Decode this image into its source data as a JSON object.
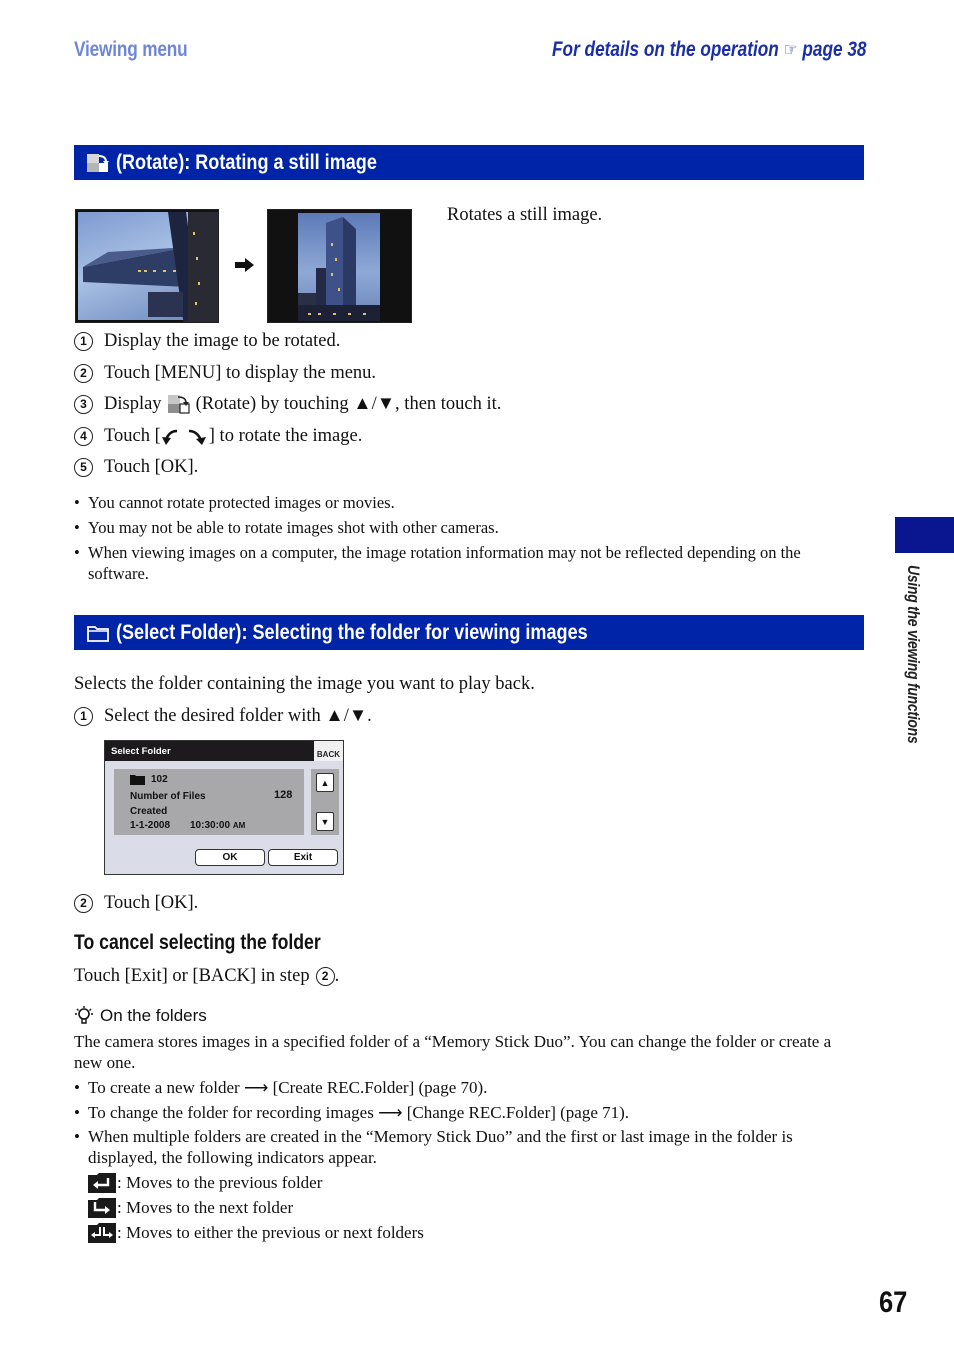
{
  "header": {
    "section_name": "Viewing menu",
    "details_prefix": "For details on the operation",
    "details_icon": "pointing-hand-icon",
    "details_page": "page 38"
  },
  "rotate_section": {
    "title": "(Rotate): Rotating a still image",
    "icon": "rotate-icon",
    "description": "Rotates a still image.",
    "before_image": "landscape-building-photo",
    "after_image": "portrait-building-photo",
    "steps": [
      {
        "num": "1",
        "text": "Display the image to be rotated."
      },
      {
        "num": "2",
        "text": "Touch [MENU] to display the menu."
      },
      {
        "num": "3",
        "text_before": "Display",
        "text_after": "(Rotate) by touching ▲/▼, then touch it."
      },
      {
        "num": "4",
        "text_before": "Touch [",
        "text_after": "] to rotate the image."
      },
      {
        "num": "5",
        "text": "Touch [OK]."
      }
    ],
    "notes": [
      "You cannot rotate protected images or movies.",
      "You may not be able to rotate images shot with other cameras.",
      "When viewing images on a computer, the image rotation information may not be reflected depending on the software."
    ]
  },
  "folder_section": {
    "title": "(Select Folder): Selecting the folder for viewing images",
    "icon": "folder-icon",
    "description": "Selects the folder containing the image you want to play back.",
    "steps": [
      {
        "num": "1",
        "text": "Select the desired folder with ▲/▼."
      },
      {
        "num": "2",
        "text": "Touch [OK]."
      }
    ],
    "camera_screen": {
      "title": "Select Folder",
      "back": "BACK",
      "folder_name": "102",
      "files_label": "Number of Files",
      "files_count": "128",
      "created_label": "Created",
      "created_date": "1-1-2008",
      "created_time": "10:30:00",
      "created_ampm": "AM",
      "up_arrow": "▲",
      "down_arrow": "▼",
      "ok": "OK",
      "exit": "Exit"
    },
    "cancel_heading": "To cancel selecting the folder",
    "cancel_text": "Touch [Exit] or [BACK] in step",
    "cancel_step_ref": "2",
    "hint_title": "On the folders",
    "hint_body": "The camera stores images in a specified folder of a “Memory Stick Duo”. You can change the folder or create a new one.",
    "hint_bullets": [
      {
        "before": "To create a new folder",
        "after": "[Create REC.Folder] (page 70)."
      },
      {
        "before": "To change the folder for recording images",
        "after": "[Change REC.Folder] (page 71)."
      }
    ],
    "indicator_intro": "When multiple folders are created in the “Memory Stick Duo” and the first or last image in the folder is displayed, the following indicators appear.",
    "indicators": [
      {
        "icon": "previous-folder-icon",
        "text": ": Moves to the previous folder"
      },
      {
        "icon": "next-folder-icon",
        "text": ": Moves to the next folder"
      },
      {
        "icon": "previous-or-next-folder-icon",
        "text": ": Moves to either the previous or next folders"
      }
    ]
  },
  "side_tab": {
    "label": "Using the viewing functions",
    "color": "#0a1590"
  },
  "page_number": "67",
  "colors": {
    "section_bar": "#0024a8",
    "header_left": "#6f86d6",
    "header_right": "#1a2ea8"
  }
}
